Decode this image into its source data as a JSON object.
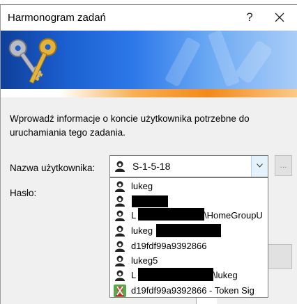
{
  "dialog": {
    "title": "Harmonogram zadań",
    "help_glyph": "?",
    "info_text": "Wprowadź informacje o koncie użytkownika potrzebne do uruchamiania tego zadania."
  },
  "form": {
    "username_label": "Nazwa użytkownika:",
    "password_label": "Hasło:",
    "username_value": "S-1-5-18",
    "browse_label": "..."
  },
  "dropdown": {
    "items": [
      {
        "text": "lukeg",
        "icon": "user-icon"
      },
      {
        "text": "",
        "icon": "user-icon"
      },
      {
        "text": "L",
        "suffix": "\\HomeGroupU",
        "icon": "user-icon"
      },
      {
        "text": "lukeg",
        "icon": "user-icon"
      },
      {
        "text": "d19fdf99a9392866",
        "icon": "user-icon"
      },
      {
        "text": "lukeg5",
        "icon": "user-icon"
      },
      {
        "text": "L",
        "suffix": "\\lukeg",
        "icon": "user-icon"
      },
      {
        "text": "d19fdf99a9392866 - Token Sig",
        "icon": "token-user-icon"
      }
    ]
  },
  "colors": {
    "banner_dark": "#0f3f9a",
    "banner_light": "#a9cdf8",
    "banner_accent": "#f08a1c",
    "dialog_bg": "#f0f0f0"
  }
}
